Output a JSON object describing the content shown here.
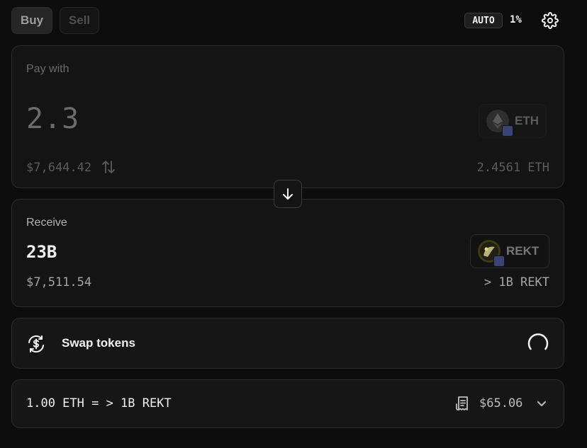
{
  "tabs": {
    "buy": "Buy",
    "sell": "Sell"
  },
  "settings": {
    "auto_label": "AUTO",
    "slippage": "1%"
  },
  "pay": {
    "label": "Pay with",
    "amount": "2.3",
    "usd_value": "$7,644.42",
    "token": "ETH",
    "balance": "2.4561 ETH"
  },
  "receive": {
    "label": "Receive",
    "amount": "23B",
    "usd_value": "$7,511.54",
    "token": "REKT",
    "approx": "> 1B REKT"
  },
  "swap": {
    "label": "Swap tokens"
  },
  "rate": {
    "text": "1.00 ETH = > 1B REKT",
    "fee": "$65.06"
  },
  "colors": {
    "background": "#0d0d0d",
    "card": "#141414",
    "border": "#2a2a2a",
    "chain_badge": "#3b4372"
  },
  "icons": [
    "gear-icon",
    "eth-logo-icon",
    "rekt-logo-icon",
    "arrow-down-icon",
    "swap-arrows-icon",
    "swap-dollar-icon",
    "loading-spinner-icon",
    "receipt-icon",
    "chevron-down-icon"
  ]
}
